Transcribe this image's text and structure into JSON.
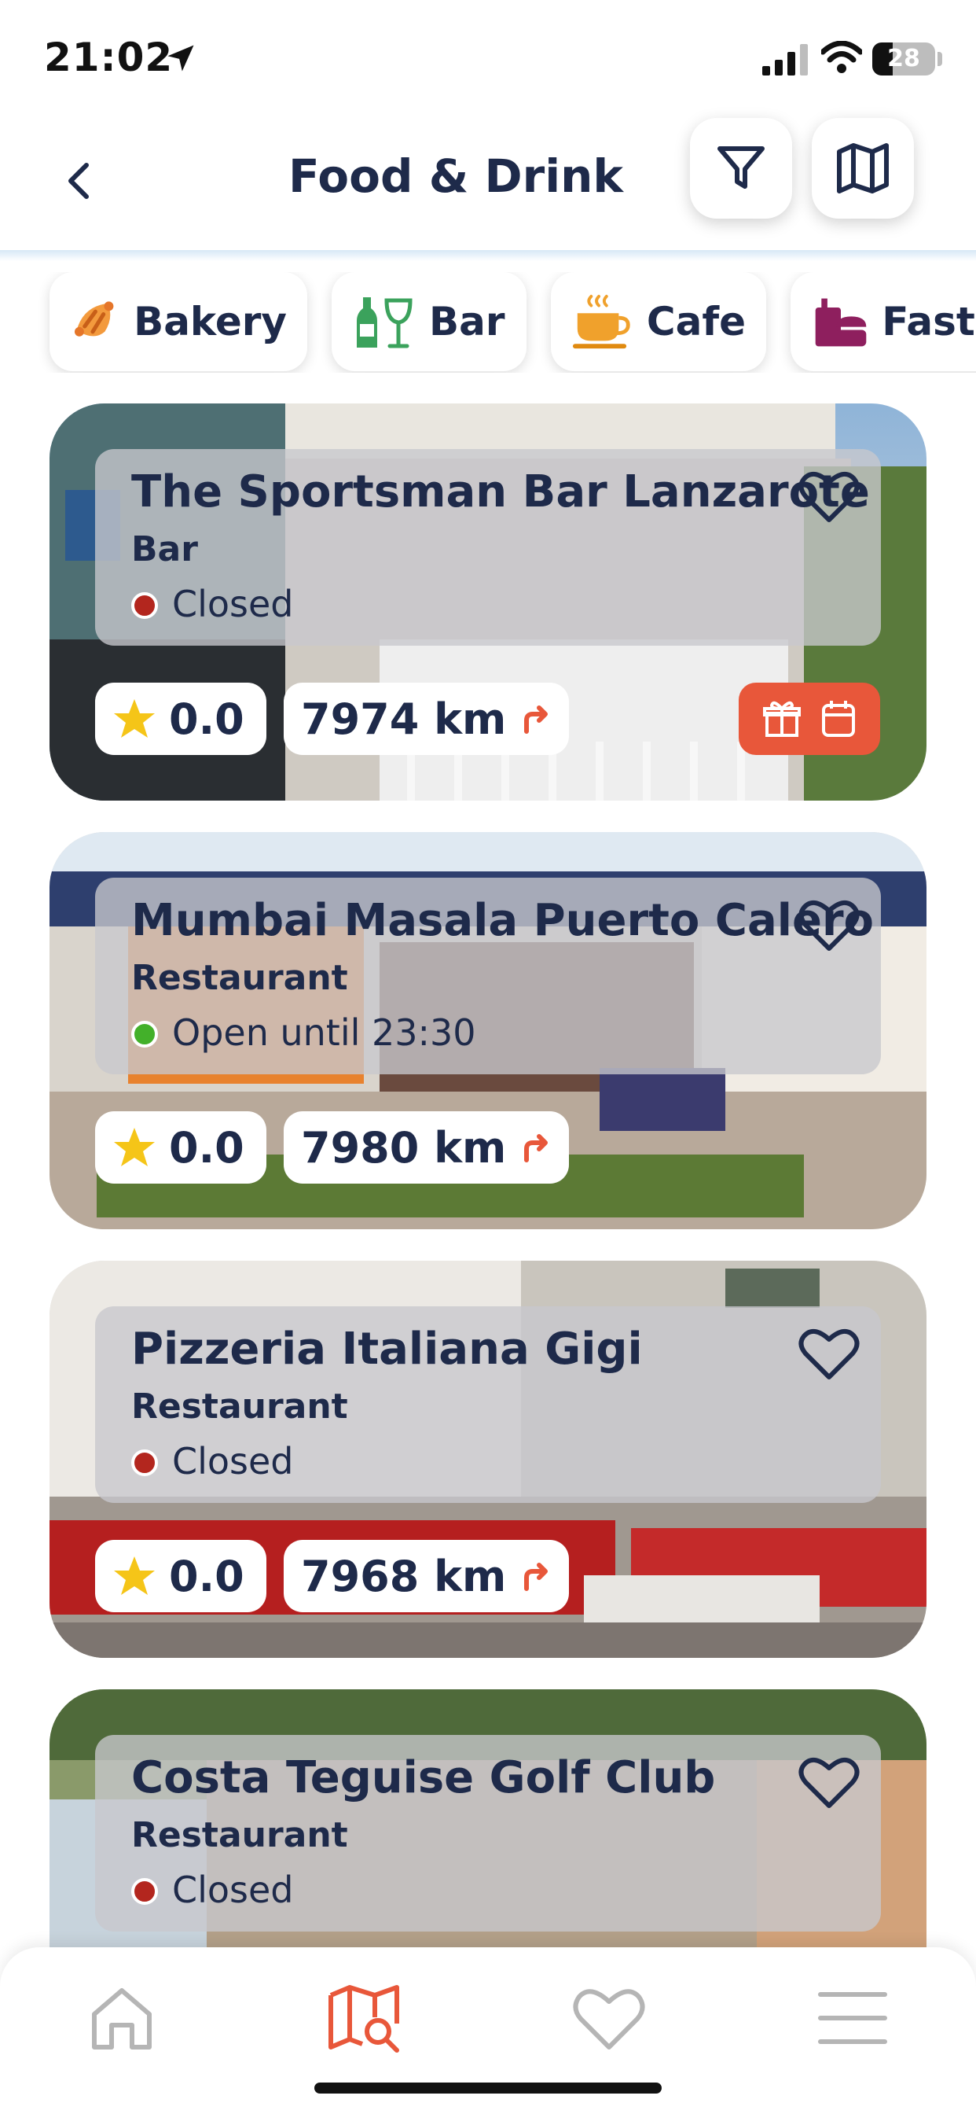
{
  "status_bar": {
    "time": "21:02",
    "battery": "28"
  },
  "header": {
    "title": "Food & Drink"
  },
  "categories": [
    {
      "label": "Bakery",
      "icon": "croissant-icon"
    },
    {
      "label": "Bar",
      "icon": "bottle-glass-icon"
    },
    {
      "label": "Cafe",
      "icon": "coffee-cup-icon"
    },
    {
      "label": "Fast f",
      "icon": "fast-food-icon"
    }
  ],
  "places": [
    {
      "name": "The Sportsman Bar Lanzarote",
      "type": "Bar",
      "status": "Closed",
      "status_color": "#b3261e",
      "rating": "0.0",
      "distance": "7974 km",
      "has_offers": true
    },
    {
      "name": "Mumbai Masala Puerto Calero",
      "type": "Restaurant",
      "status": "Open until 23:30",
      "status_color": "#43b02a",
      "rating": "0.0",
      "distance": "7980 km",
      "has_offers": false
    },
    {
      "name": "Pizzeria Italiana Gigi",
      "type": "Restaurant",
      "status": "Closed",
      "status_color": "#b3261e",
      "rating": "0.0",
      "distance": "7968 km",
      "has_offers": false
    },
    {
      "name": "Costa Teguise Golf Club",
      "type": "Restaurant",
      "status": "Closed",
      "status_color": "#b3261e",
      "rating": "",
      "distance": "",
      "has_offers": false
    }
  ],
  "colors": {
    "accent": "#e8573a",
    "navy": "#1e2a4a",
    "star": "#f5c518",
    "inactive_icon": "#b5b5b5"
  },
  "bottom_nav": [
    {
      "icon": "home-icon",
      "active": false
    },
    {
      "icon": "map-search-icon",
      "active": true
    },
    {
      "icon": "heart-icon",
      "active": false
    },
    {
      "icon": "menu-icon",
      "active": false
    }
  ]
}
